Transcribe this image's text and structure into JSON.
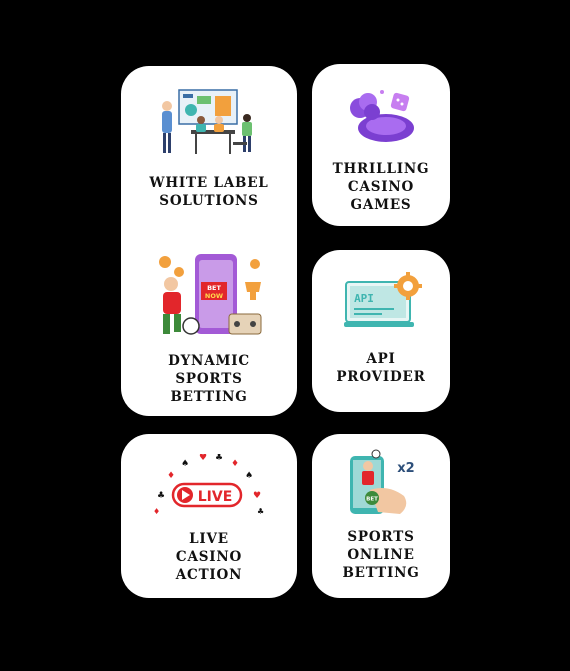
{
  "cards": {
    "white_label": {
      "lines": [
        "WHITE LABEL",
        "SOLUTIONS"
      ]
    },
    "dynamic_sports": {
      "lines": [
        "DYNAMIC",
        "SPORTS",
        "BETTING"
      ],
      "badge": [
        "BET",
        "NOW"
      ]
    },
    "thrilling_casino": {
      "lines": [
        "THRILLING",
        "CASINO",
        "GAMES"
      ]
    },
    "api_provider": {
      "lines": [
        "API",
        "PROVIDER"
      ],
      "screen_text": "API"
    },
    "live_casino": {
      "lines": [
        "LIVE",
        "CASINO",
        "ACTION"
      ],
      "badge": "LIVE"
    },
    "sports_online": {
      "lines": [
        "SPORTS",
        "ONLINE",
        "BETTING"
      ],
      "multiplier": "x2",
      "chip": "BET"
    }
  },
  "colors": {
    "accent_red": "#e2262b",
    "teal": "#3fb5b0",
    "purple": "#7b3fd1",
    "orange": "#f2a03d"
  },
  "icons": [
    "team-presentation-icon",
    "casino-chips-icon",
    "sports-betting-phone-icon",
    "api-monitor-icon",
    "live-stream-icon",
    "mobile-sports-bet-icon"
  ]
}
